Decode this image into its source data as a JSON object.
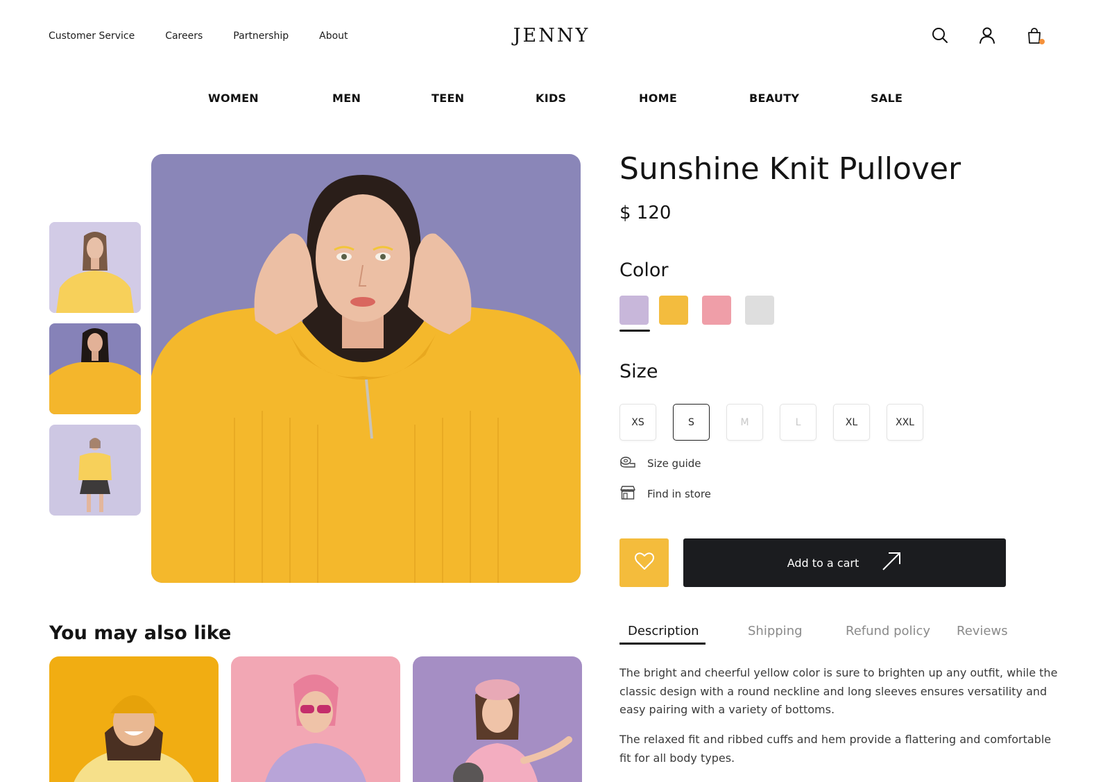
{
  "brand": {
    "logo": "JENNY"
  },
  "utility_nav": [
    {
      "label": "Customer Service"
    },
    {
      "label": "Careers"
    },
    {
      "label": "Partnership"
    },
    {
      "label": "About"
    }
  ],
  "header_icons": [
    "search-icon",
    "user-icon",
    "shopping-bag-icon"
  ],
  "main_nav": [
    {
      "label": "WOMEN"
    },
    {
      "label": "MEN"
    },
    {
      "label": "TEEN"
    },
    {
      "label": "KIDS"
    },
    {
      "label": "HOME"
    },
    {
      "label": "BEAUTY"
    },
    {
      "label": "SALE"
    }
  ],
  "product": {
    "title": "Sunshine Knit Pullover",
    "price": "$ 120",
    "color_label": "Color",
    "colors": [
      {
        "name": "lavender",
        "hex": "#c8b7da",
        "selected": true
      },
      {
        "name": "yellow",
        "hex": "#f3bc3e",
        "selected": false
      },
      {
        "name": "pink",
        "hex": "#ef9ea8",
        "selected": false
      },
      {
        "name": "light-gray",
        "hex": "#dedede",
        "selected": false
      }
    ],
    "size_label": "Size",
    "sizes": [
      {
        "label": "XS",
        "state": "available"
      },
      {
        "label": "S",
        "state": "selected"
      },
      {
        "label": "M",
        "state": "unavailable"
      },
      {
        "label": "L",
        "state": "unavailable"
      },
      {
        "label": "XL",
        "state": "available"
      },
      {
        "label": "XXL",
        "state": "available"
      }
    ],
    "size_guide": "Size guide",
    "find_in_store": "Find in store",
    "add_to_cart": "Add to a cart"
  },
  "tabs": [
    {
      "label": "Description",
      "active": true
    },
    {
      "label": "Shipping",
      "active": false
    },
    {
      "label": "Refund policy",
      "active": false
    },
    {
      "label": "Reviews",
      "active": false
    }
  ],
  "description": {
    "paragraph_1": "The bright and cheerful yellow color is sure to brighten up any outfit, while the classic design with a round neckline and long sleeves ensures versatility and easy pairing with a variety of bottoms.",
    "paragraph_2": "The relaxed fit and ribbed cuffs and hem provide a flattering and comfortable fit for all body types."
  },
  "recommendations": {
    "title": "You may also like"
  },
  "colors": {
    "accent_yellow": "#f4bc3c",
    "dark_button": "#1b1c1f",
    "cart_badge": "#f5913a",
    "photo_background": "#8a86b8"
  }
}
